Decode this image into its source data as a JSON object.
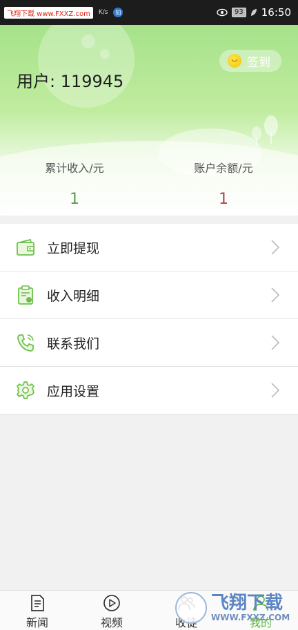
{
  "status_bar": {
    "watermark_badge": "飞翔下载 www.FXXZ.com",
    "net_speed": "K/s",
    "app_badge": "知",
    "battery": "93",
    "time": "16:50"
  },
  "header": {
    "user_label": "用户: 119945",
    "signin_label": "签到"
  },
  "stats": {
    "total_income_label": "累计收入/元",
    "total_income_value": "1",
    "balance_label": "账户余额/元",
    "balance_value": "1"
  },
  "menu": {
    "items": [
      {
        "label": "立即提现",
        "icon": "wallet-icon"
      },
      {
        "label": "收入明细",
        "icon": "clipboard-icon"
      },
      {
        "label": "联系我们",
        "icon": "phone-icon"
      },
      {
        "label": "应用设置",
        "icon": "gear-icon"
      }
    ]
  },
  "bottom_nav": {
    "items": [
      {
        "label": "新闻",
        "icon": "document-icon"
      },
      {
        "label": "视频",
        "icon": "play-icon"
      },
      {
        "label": "收徒",
        "icon": "people-icon"
      },
      {
        "label": "我的",
        "icon": "user-icon"
      }
    ],
    "active_index": 3
  },
  "watermark": {
    "main": "飞翔下载",
    "sub": "WWW.FXXZ.COM"
  },
  "colors": {
    "accent_green": "#5fb83f",
    "income_green": "#5a9d4a",
    "balance_red": "#b2414a",
    "header_green": "#a6e28a"
  }
}
